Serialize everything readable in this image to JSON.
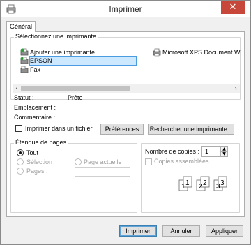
{
  "window": {
    "title": "Imprimer",
    "close_glyph": "✕"
  },
  "tabs": [
    {
      "label": "Général"
    }
  ],
  "select_printer": {
    "legend": "Sélectionnez une imprimante",
    "printers": [
      {
        "label": "Ajouter une imprimante",
        "icon": "add-printer-icon"
      },
      {
        "label": "EPSON",
        "icon": "printer-icon",
        "selected": true
      },
      {
        "label": "Fax",
        "icon": "fax-icon"
      },
      {
        "label": "Microsoft XPS Document W",
        "icon": "printer-icon"
      }
    ],
    "scroll_left": "‹",
    "scroll_right": "›"
  },
  "info": {
    "status_label": "Statut :",
    "status_value": "Prête",
    "location_label": "Emplacement :",
    "comment_label": "Commentaire :"
  },
  "print_to_file": {
    "label": "Imprimer dans un fichier",
    "checked": false
  },
  "buttons": {
    "preferences": "Préférences",
    "find_printer": "Rechercher une imprimante...",
    "print": "Imprimer",
    "cancel": "Annuler",
    "apply": "Appliquer"
  },
  "page_range": {
    "legend": "Étendue de pages",
    "all": "Tout",
    "selection": "Sélection",
    "current_page": "Page actuelle",
    "pages": "Pages :",
    "selected": "all"
  },
  "copies": {
    "label": "Nombre de copies :",
    "value": "1",
    "collate_label": "Copies assemblées",
    "collate_checked": false,
    "collate_icons": [
      "1",
      "1",
      "2",
      "2",
      "3",
      "3"
    ]
  }
}
